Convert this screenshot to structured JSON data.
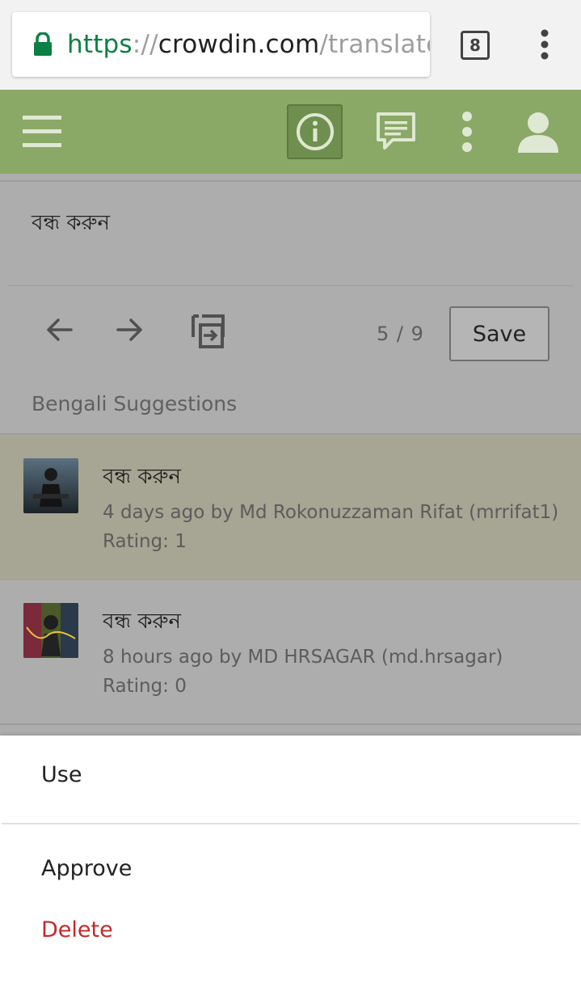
{
  "browser": {
    "url_scheme": "https",
    "url_separator": "://",
    "url_host": "crowdin.com",
    "url_path": "/translate",
    "tab_count": "8",
    "colors": {
      "secure": "#0b8043",
      "chrome_bg": "#f2f2f2"
    }
  },
  "app_bar": {
    "color": "#8aa866",
    "icons": [
      "menu-icon",
      "info-icon",
      "comment-icon",
      "more-vert-icon",
      "account-icon"
    ]
  },
  "editor": {
    "translation_text": "বন্ধ করুন",
    "counter": "5 / 9",
    "save_label": "Save"
  },
  "suggestions": {
    "header": "Bengali Suggestions",
    "items": [
      {
        "text": "বন্ধ করুন",
        "meta": "4 days ago by Md Rokonuzzaman Rifat (mrrifat1)",
        "rating": "Rating: 1"
      },
      {
        "text": "বন্ধ করুন",
        "meta": "8 hours ago by MD HRSAGAR (md.hrsagar)",
        "rating": "Rating: 0"
      }
    ]
  },
  "action_sheet": {
    "use_label": "Use",
    "approve_label": "Approve",
    "delete_label": "Delete",
    "delete_color": "#c62828"
  }
}
